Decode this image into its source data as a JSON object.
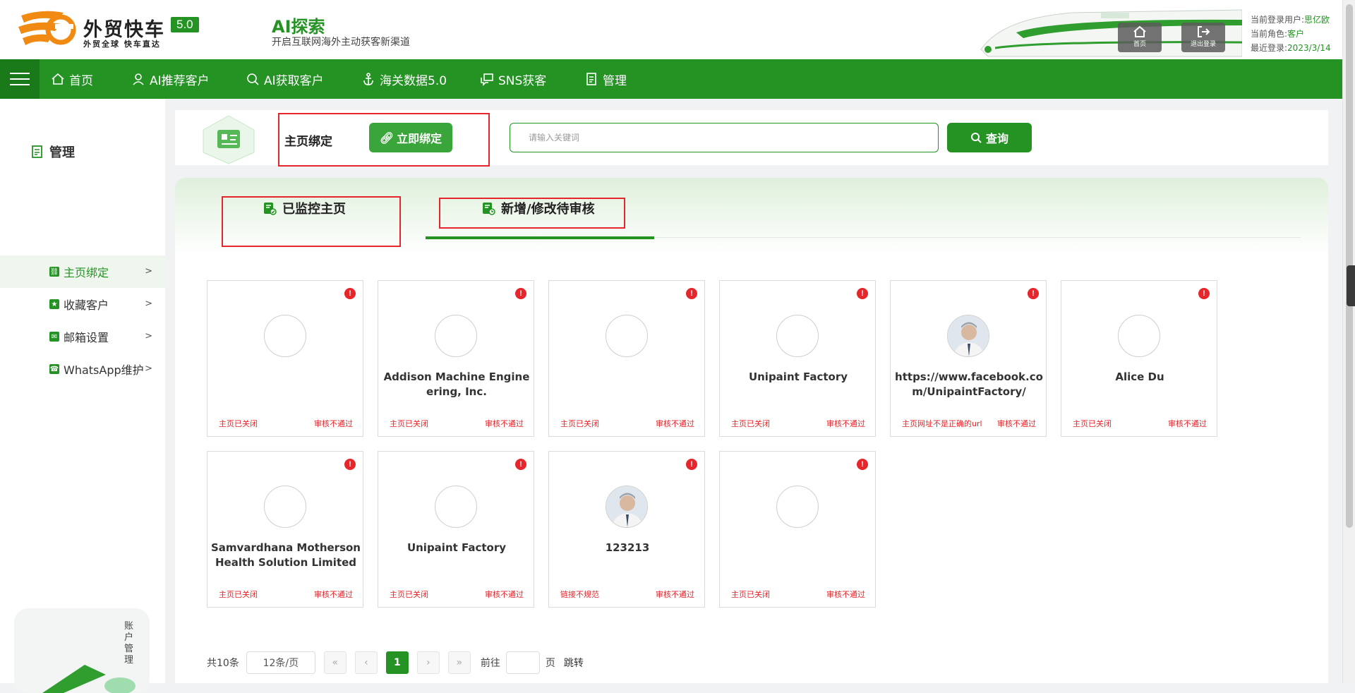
{
  "brand": {
    "name": "外贸快车",
    "version": "5.0",
    "slogan": "外贸全球 快车直达"
  },
  "header": {
    "title": "AI探索",
    "subtitle": "开启互联网海外主动获客新渠道",
    "home_label": "首页",
    "logout_label": "退出登录",
    "user_label": "当前登录用户:",
    "user_value": "思亿欧",
    "role_label": "当前角色:",
    "role_value": "客户",
    "last_login_label": "最近登录:",
    "last_login_value": "2023/3/14"
  },
  "nav": {
    "items": [
      {
        "label": "首页",
        "icon": "home-icon"
      },
      {
        "label": "AI推荐客户",
        "icon": "user-icon"
      },
      {
        "label": "AI获取客户",
        "icon": "search-user-icon"
      },
      {
        "label": "海关数据5.0",
        "icon": "anchor-icon"
      },
      {
        "label": "SNS获客",
        "icon": "chat-icon"
      },
      {
        "label": "管理",
        "icon": "document-icon"
      }
    ]
  },
  "sidebar": {
    "title": "管理",
    "items": [
      {
        "label": "主页绑定",
        "active": true
      },
      {
        "label": "收藏客户"
      },
      {
        "label": "邮箱设置"
      },
      {
        "label": "WhatsApp维护"
      }
    ],
    "account_label": "账户管理"
  },
  "topbar": {
    "bind_label": "主页绑定",
    "bind_button": "立即绑定",
    "search_placeholder": "请输入关键词",
    "query_button": "查询"
  },
  "tabs": [
    {
      "label": "已监控主页",
      "active": false
    },
    {
      "label": "新增/修改待审核",
      "active": true
    }
  ],
  "cards": [
    {
      "name": "",
      "status": "主页已关闭",
      "review": "审核不通过",
      "has_photo": false
    },
    {
      "name": "Addison Machine Engineering, Inc.",
      "status": "主页已关闭",
      "review": "审核不通过",
      "has_photo": false
    },
    {
      "name": "",
      "status": "主页已关闭",
      "review": "审核不通过",
      "has_photo": false
    },
    {
      "name": "Unipaint Factory",
      "status": "主页已关闭",
      "review": "审核不通过",
      "has_photo": false
    },
    {
      "name": "https://www.facebook.com/UnipaintFactory/",
      "status": "主页网址不是正确的url",
      "review": "审核不通过",
      "has_photo": true
    },
    {
      "name": "Alice Du",
      "status": "主页已关闭",
      "review": "审核不通过",
      "has_photo": false
    },
    {
      "name": "Samvardhana Motherson Health Solution Limited",
      "status": "主页已关闭",
      "review": "审核不通过",
      "has_photo": false
    },
    {
      "name": "Unipaint Factory",
      "status": "主页已关闭",
      "review": "审核不通过",
      "has_photo": false
    },
    {
      "name": "123213",
      "status": "链接不规范",
      "review": "审核不通过",
      "has_photo": true
    },
    {
      "name": "",
      "status": "主页已关闭",
      "review": "审核不通过",
      "has_photo": false
    }
  ],
  "pagination": {
    "total": "共10条",
    "page_size": "12条/页",
    "first": "«",
    "prev": "‹",
    "current": "1",
    "next": "›",
    "last": "»",
    "goto_label": "前往",
    "page_unit": "页",
    "jump": "跳转"
  },
  "colors": {
    "primary": "#249324",
    "alert": "#e6262b"
  }
}
